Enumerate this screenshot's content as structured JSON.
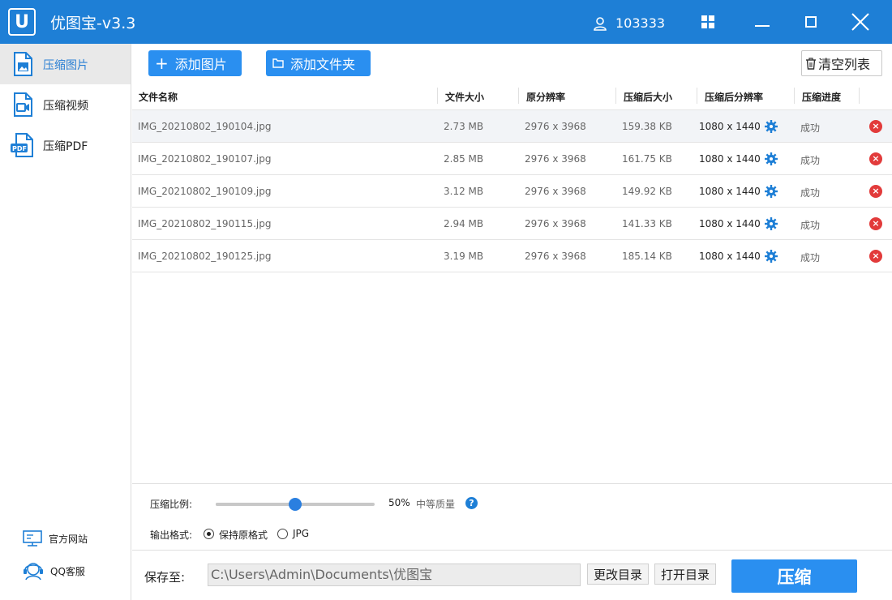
{
  "app": {
    "logo_letter": "U",
    "title": "优图宝-v3.3",
    "user_id": "103333",
    "accent_color": "#1e7fd6"
  },
  "sidebar": {
    "items": [
      {
        "label": "压缩图片",
        "icon": "image-file-icon",
        "active": true
      },
      {
        "label": "压缩视频",
        "icon": "video-file-icon",
        "active": false
      },
      {
        "label": "压缩PDF",
        "icon": "pdf-file-icon",
        "active": false
      }
    ],
    "links": [
      {
        "label": "官方网站",
        "icon": "monitor-icon"
      },
      {
        "label": "QQ客服",
        "icon": "headset-icon"
      }
    ]
  },
  "toolbar": {
    "add_image": "添加图片",
    "add_folder": "添加文件夹",
    "clear_list": "清空列表"
  },
  "table": {
    "columns": [
      "文件名称",
      "文件大小",
      "原分辨率",
      "压缩后大小",
      "压缩后分辨率",
      "压缩进度"
    ],
    "rows": [
      {
        "name": "IMG_20210802_190104.jpg",
        "size": "2.73 MB",
        "orig_res": "2976 x 3968",
        "new_size": "159.38 KB",
        "new_res": "1080 x 1440",
        "status": "成功"
      },
      {
        "name": "IMG_20210802_190107.jpg",
        "size": "2.85 MB",
        "orig_res": "2976 x 3968",
        "new_size": "161.75 KB",
        "new_res": "1080 x 1440",
        "status": "成功"
      },
      {
        "name": "IMG_20210802_190109.jpg",
        "size": "3.12 MB",
        "orig_res": "2976 x 3968",
        "new_size": "149.92 KB",
        "new_res": "1080 x 1440",
        "status": "成功"
      },
      {
        "name": "IMG_20210802_190115.jpg",
        "size": "2.94 MB",
        "orig_res": "2976 x 3968",
        "new_size": "141.33 KB",
        "new_res": "1080 x 1440",
        "status": "成功"
      },
      {
        "name": "IMG_20210802_190125.jpg",
        "size": "3.19 MB",
        "orig_res": "2976 x 3968",
        "new_size": "185.14 KB",
        "new_res": "1080 x 1440",
        "status": "成功"
      }
    ]
  },
  "settings": {
    "ratio_label": "压缩比例:",
    "ratio_value": 50,
    "ratio_text": "50%",
    "quality_text": "中等质量",
    "help_symbol": "?",
    "format_label": "输出格式:",
    "format_options": [
      {
        "label": "保持原格式",
        "checked": true
      },
      {
        "label": "JPG",
        "checked": false
      }
    ]
  },
  "footer": {
    "save_label": "保存至:",
    "save_path": "C:\\Users\\Admin\\Documents\\优图宝",
    "change_dir": "更改目录",
    "open_dir": "打开目录",
    "compress": "压缩"
  }
}
